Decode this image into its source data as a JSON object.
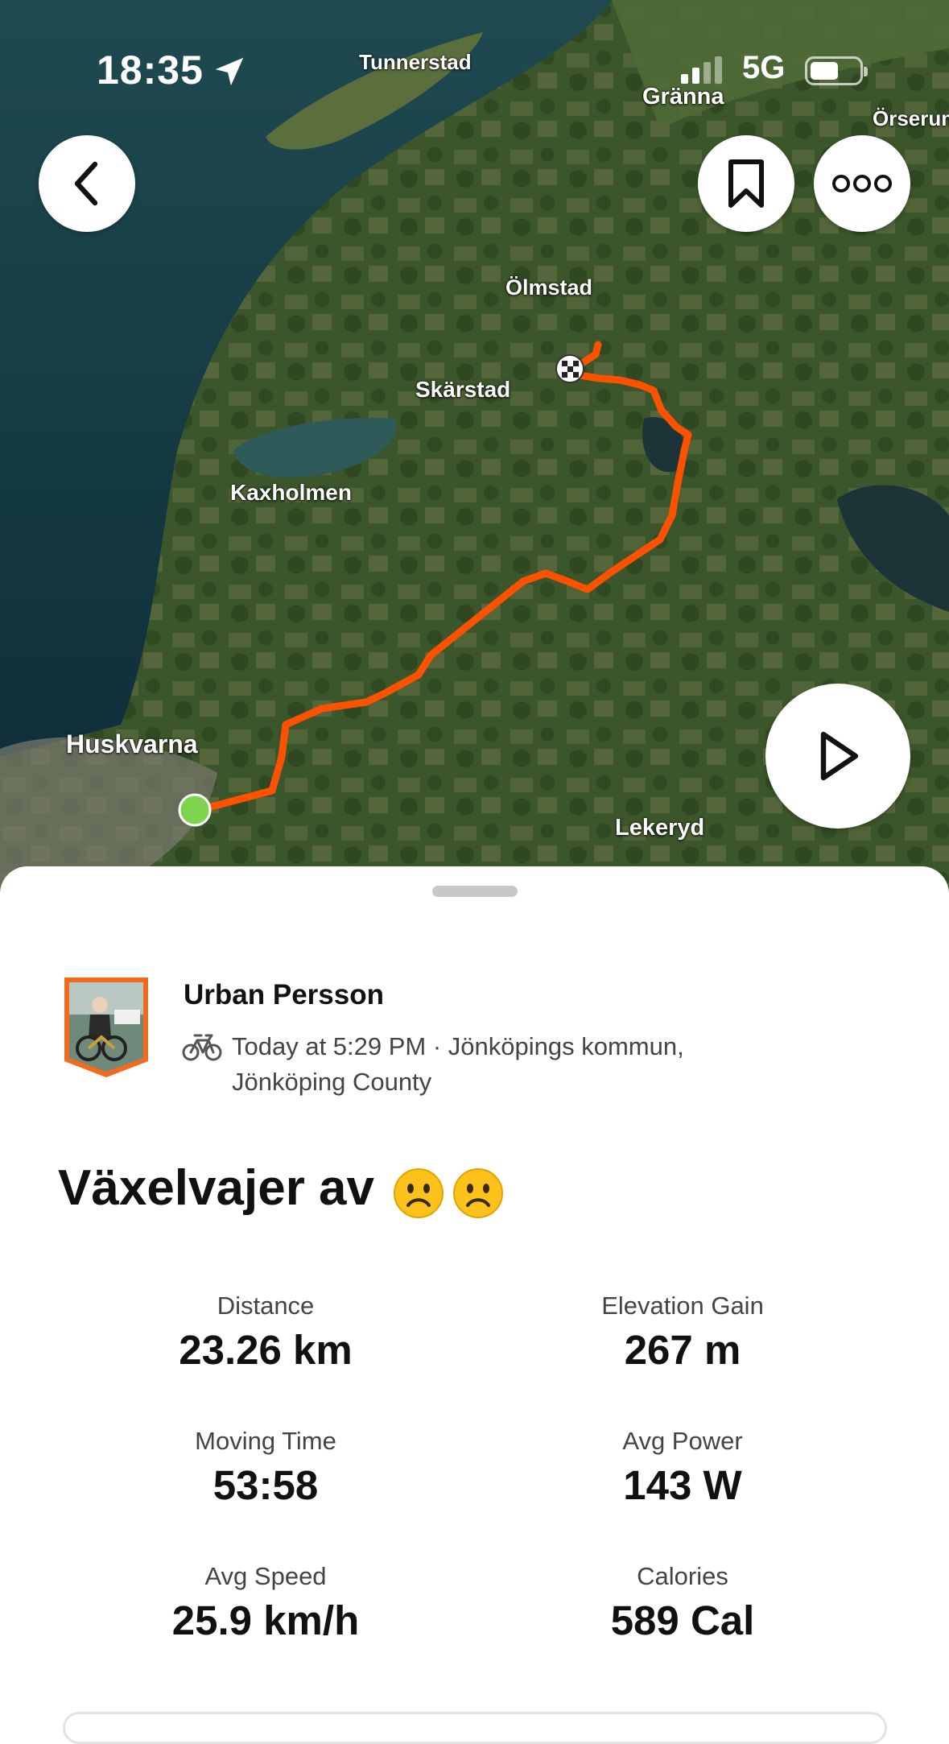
{
  "status_bar": {
    "time": "18:35",
    "network": "5G"
  },
  "map": {
    "places": [
      "Tunnerstad",
      "Gränna",
      "Örserum",
      "Ölmstad",
      "Skärstad",
      "Kaxholmen",
      "Huskvarna",
      "Lekeryd"
    ],
    "route_color": "#fc5200",
    "start_marker_color": "#7ed34f"
  },
  "activity": {
    "athlete": "Urban Persson",
    "meta_line1": "Today at 5:29 PM · Jönköpings kommun,",
    "meta_line2": "Jönköping County",
    "title": "Växelvajer av",
    "stats": [
      {
        "label": "Distance",
        "value": "23.26 km"
      },
      {
        "label": "Elevation Gain",
        "value": "267 m"
      },
      {
        "label": "Moving Time",
        "value": "53:58"
      },
      {
        "label": "Avg Power",
        "value": "143 W"
      },
      {
        "label": "Avg Speed",
        "value": "25.9 km/h"
      },
      {
        "label": "Calories",
        "value": "589 Cal"
      }
    ]
  },
  "icons": {
    "back": "chevron-left-icon",
    "bookmark": "bookmark-icon",
    "more": "more-icon",
    "play": "play-icon",
    "sport": "bike-icon",
    "location": "location-arrow-icon"
  }
}
